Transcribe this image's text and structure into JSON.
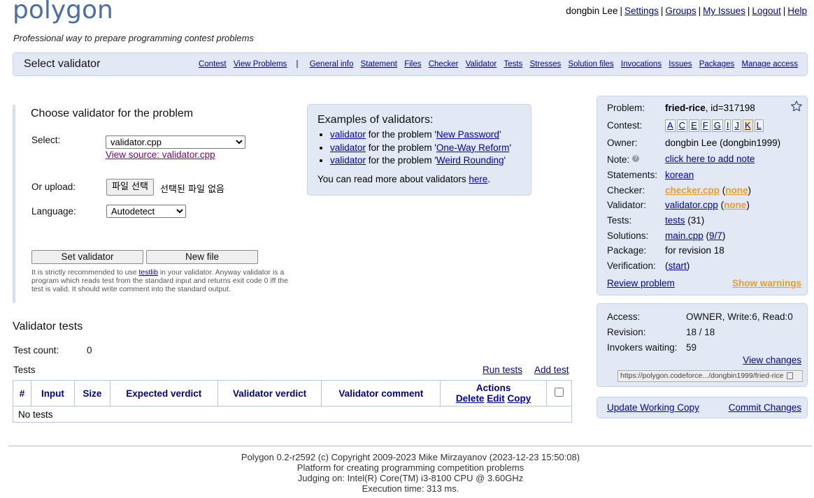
{
  "header": {
    "logo": "polygon",
    "tagline": "Professional way to prepare programming contest problems",
    "user": "dongbin Lee",
    "links": [
      "Settings",
      "Groups",
      "My Issues",
      "Logout",
      "Help"
    ]
  },
  "menubar": {
    "title": "Select validator",
    "left_links": [
      "Contest",
      "View Problems"
    ],
    "separator": "|",
    "right_links": [
      "General info",
      "Statement",
      "Files",
      "Checker",
      "Validator",
      "Tests",
      "Stresses",
      "Solution files",
      "Invocations",
      "Issues",
      "Packages",
      "Manage access"
    ]
  },
  "choose": {
    "title": "Choose validator for the problem",
    "select_label": "Select:",
    "select_value": "validator.cpp",
    "view_source": "View source: validator.cpp",
    "upload_label": "Or upload:",
    "file_button": "파일 선택",
    "no_file": "선택된 파일 없음",
    "language_label": "Language:",
    "language_value": "Autodetect",
    "set_button": "Set validator",
    "new_file_button": "New file",
    "note_pre": "It is strictly recommended to use ",
    "note_link": "testlib",
    "note_post": " in your validator. Anyway validator is a program which reads test from the standard input and returns exit code 0 iff the test is valid. It should write comment into the standard output."
  },
  "examples": {
    "title": "Examples of validators:",
    "link_text": "validator",
    "for_text": " for the problem '",
    "end_text": "'",
    "items": [
      "New Password",
      "One-Way Reform",
      "Weird Rounding"
    ],
    "more_text": "You can read more about validators ",
    "more_link": "here",
    "more_end": "."
  },
  "tests_section": {
    "title": "Validator tests",
    "count_label": "Test count:",
    "count_value": "0",
    "tests_label": "Tests",
    "run_tests": "Run tests",
    "add_test": "Add test",
    "columns": [
      "#",
      "Input",
      "Size",
      "Expected verdict",
      "Validator verdict",
      "Validator comment"
    ],
    "actions_header": "Actions",
    "actions": [
      "Delete",
      "Edit",
      "Copy"
    ],
    "empty_text": "No tests"
  },
  "info": {
    "problem_label": "Problem:",
    "problem_name": "fried-rice",
    "problem_id": ", id=317198",
    "contest_label": "Contest:",
    "contest_letters": [
      "A",
      "C",
      "E",
      "F",
      "G",
      "I",
      "J",
      "K",
      "L"
    ],
    "owner_label": "Owner:",
    "owner_value": "dongbin Lee (dongbin1999)",
    "note_label": "Note:",
    "note_value": "click here to add note",
    "statements_label": "Statements:",
    "statements_value": "korean",
    "checker_label": "Checker:",
    "checker_value": "checker.cpp",
    "checker_extra": "none",
    "validator_label": "Validator:",
    "validator_value": "validator.cpp",
    "validator_extra": "none",
    "tests_label": "Tests:",
    "tests_link": "tests",
    "tests_count": " (31)",
    "solutions_label": "Solutions:",
    "solutions_value": "main.cpp",
    "solutions_extra": "9/7",
    "package_label": "Package:",
    "package_value": "for revision 18",
    "verification_label": "Verification:",
    "verification_value": "start",
    "review": "Review problem",
    "warnings": "Show warnings"
  },
  "access": {
    "access_label": "Access:",
    "access_value": "OWNER, Write:6, Read:0",
    "revision_label": "Revision:",
    "revision_value": "18 / 18",
    "invokers_label": "Invokers waiting:",
    "invokers_value": "59",
    "view_changes": "View changes",
    "url": "https://polygon.codeforce.../dongbin1999/fried-rice"
  },
  "working_copy": {
    "update": "Update Working Copy",
    "commit": "Commit Changes"
  },
  "footer": {
    "line1": "Polygon 0.2-r2592 (c) Copyright 2009-2023 Mike Mirzayanov (2023-12-23 15:50:08)",
    "line2": "Platform for creating programming competition problems",
    "line3": "Judging on: Intel(R) Core(TM) i3-8100 CPU @ 3.60GHz",
    "line4": "Execution time: 313 ms."
  },
  "colors": {
    "accent": "#4b6ea6",
    "panel": "#e2e9f5",
    "link": "#0000aa",
    "warning": "#e39e2c"
  }
}
